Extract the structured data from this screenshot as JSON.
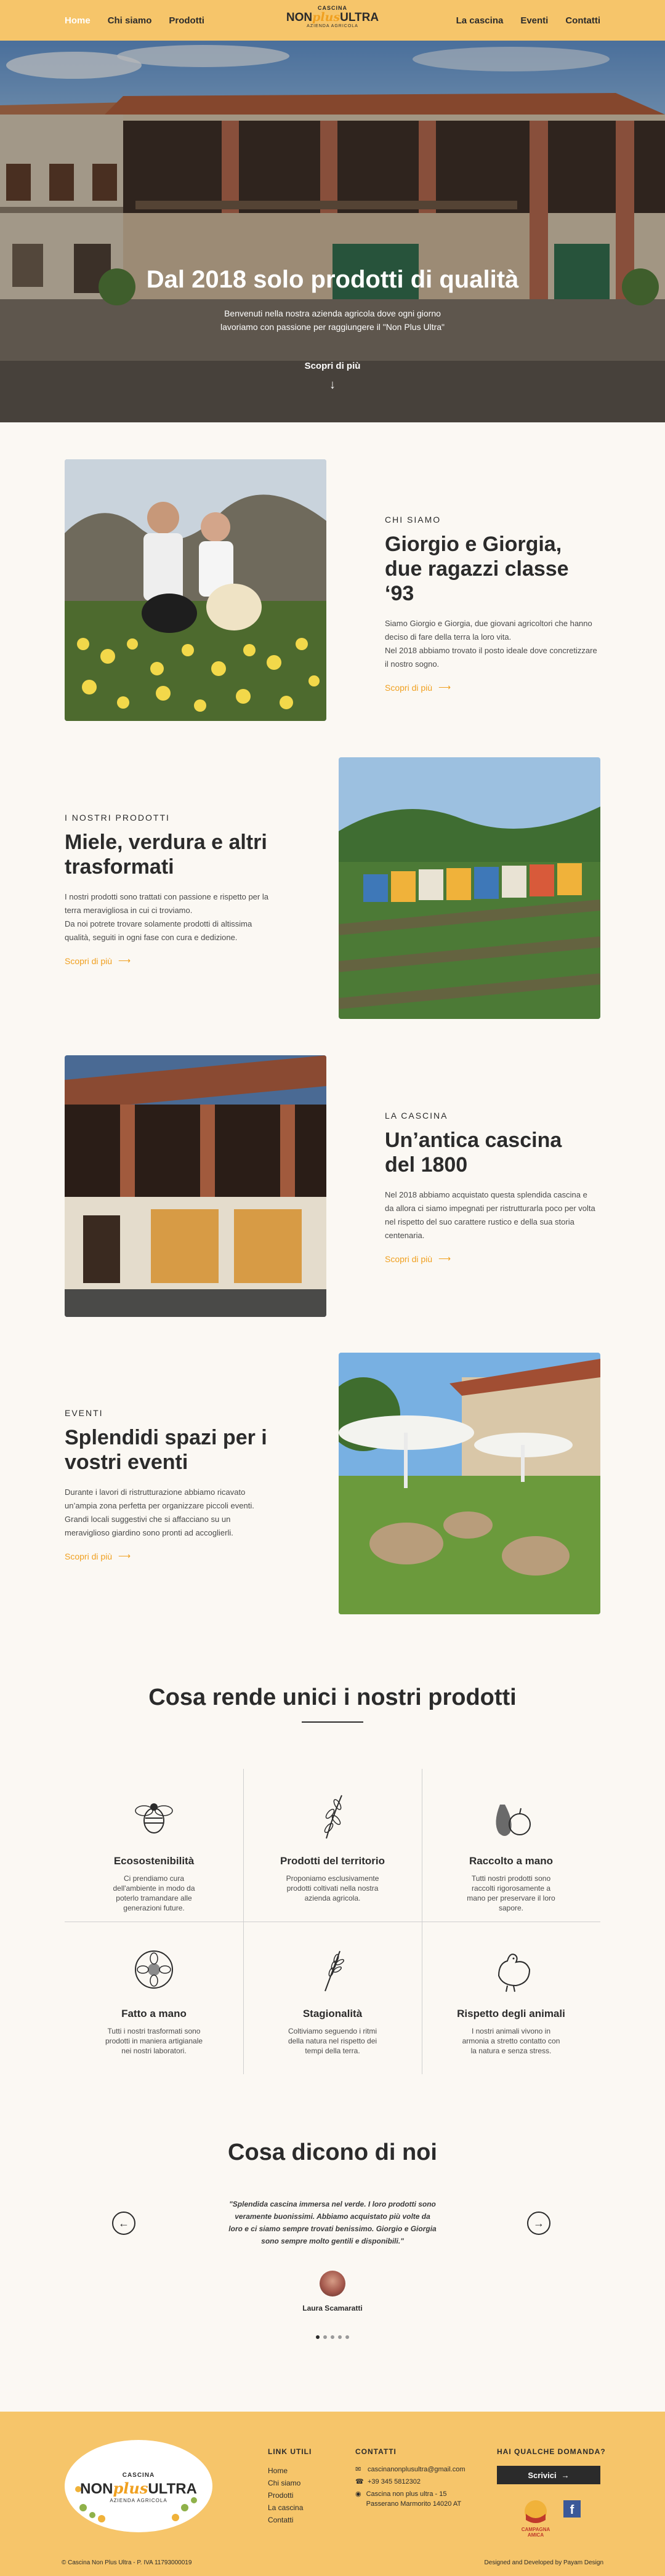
{
  "header": {
    "nav_left": [
      "Home",
      "Chi siamo",
      "Prodotti"
    ],
    "nav_right": [
      "La cascina",
      "Eventi",
      "Contatti"
    ],
    "logo": {
      "line1": "CASCINA",
      "non": "NON",
      "plus": "plus",
      "ultra": "ULTRA",
      "line3": "AZIENDA AGRICOLA"
    }
  },
  "hero": {
    "title": "Dal 2018 solo prodotti di qualità",
    "subtitle": "Benvenuti nella nostra azienda agricola dove ogni giorno lavoriamo con passione per raggiungere il \"Non Plus Ultra\"",
    "cta": "Scopri di più"
  },
  "features": [
    {
      "eyebrow": "CHI SIAMO",
      "title": "Giorgio e Giorgia, due ragazzi classe ‘93",
      "body": "Siamo Giorgio e Giorgia, due giovani agricoltori che hanno deciso di fare della terra la loro vita.\nNel 2018 abbiamo trovato il posto ideale dove concretizzare il nostro sogno.",
      "more": "Scopri di più"
    },
    {
      "eyebrow": "I NOSTRI PRODOTTI",
      "title": "Miele, verdura e altri trasformati",
      "body": "I nostri prodotti sono trattati con passione e rispetto per la terra meravigliosa in cui ci troviamo.\nDa noi potrete trovare solamente prodotti di altissima qualità, seguiti in ogni fase con cura e dedizione.",
      "more": "Scopri di più"
    },
    {
      "eyebrow": "LA CASCINA",
      "title": "Un’antica cascina del 1800",
      "body": "Nel 2018 abbiamo acquistato questa splendida cascina e da allora ci siamo impegnati per ristrutturarla poco per volta nel rispetto del suo carattere rustico e della sua storia centenaria.",
      "more": "Scopri di più"
    },
    {
      "eyebrow": "EVENTI",
      "title": "Splendidi spazi per i vostri eventi",
      "body": "Durante i lavori di ristrutturazione abbiamo ricavato un’ampia zona perfetta per organizzare piccoli eventi. Grandi locali suggestivi che si affacciano su un meraviglioso giardino sono pronti ad accoglierli.",
      "more": "Scopri di più"
    }
  ],
  "unique": {
    "title": "Cosa rende unici i nostri prodotti",
    "items": [
      {
        "icon": "bee-icon",
        "title": "Ecosostenibilità",
        "body": "Ci prendiamo cura dell'ambiente in modo da poterlo tramandare alle generazioni future."
      },
      {
        "icon": "olive-branch-icon",
        "title": "Prodotti del territorio",
        "body": "Proponiamo esclusivamente prodotti coltivati nella nostra azienda agricola."
      },
      {
        "icon": "fruit-icon",
        "title": "Raccolto a mano",
        "body": "Tutti nostri prodotti sono raccolti rigorosamente a mano per preservare il loro sapore."
      },
      {
        "icon": "flower-icon",
        "title": "Fatto a mano",
        "body": "Tutti i nostri trasformati sono prodotti in maniera artigianale nei nostri laboratori."
      },
      {
        "icon": "wheat-icon",
        "title": "Stagionalità",
        "body": "Coltiviamo seguendo i ritmi della natura nel rispetto dei tempi della terra."
      },
      {
        "icon": "hen-icon",
        "title": "Rispetto degli animali",
        "body": "I nostri animali vivono in armonia a stretto contatto con la natura e senza stress."
      }
    ]
  },
  "testimonials": {
    "title": "Cosa dicono di noi",
    "quote": "\"Splendida cascina immersa nel verde. I loro prodotti sono veramente buonissimi. Abbiamo acquistato più volte da loro e ci siamo sempre trovati benissimo. Giorgio e Giorgia sono sempre molto gentili e disponibili.\"",
    "name": "Laura Scamaratti",
    "dots": 5
  },
  "footer": {
    "logo": {
      "line1": "CASCINA",
      "non": "NON",
      "plus": "plus",
      "ultra": "ULTRA",
      "line3": "AZIENDA AGRICOLA"
    },
    "links_title": "LINK UTILI",
    "links": [
      "Home",
      "Chi siamo",
      "Prodotti",
      "La cascina",
      "Contatti"
    ],
    "contacts_title": "CONTATTI",
    "email": "cascinanonplusultra@gmail.com",
    "phone": "+39 345 5812302",
    "address": "Cascina non plus ultra - 15 Passerano Marmorito 14020 AT",
    "question_title": "HAI QUALCHE DOMANDA?",
    "write_button": "Scrivici",
    "badge_text_1": "CAMPAGNA",
    "badge_text_2": "AMICA",
    "copyright": "© Cascina Non Plus Ultra - P. IVA 11793000019",
    "credits": "Designed and Developed by Payam Design"
  }
}
